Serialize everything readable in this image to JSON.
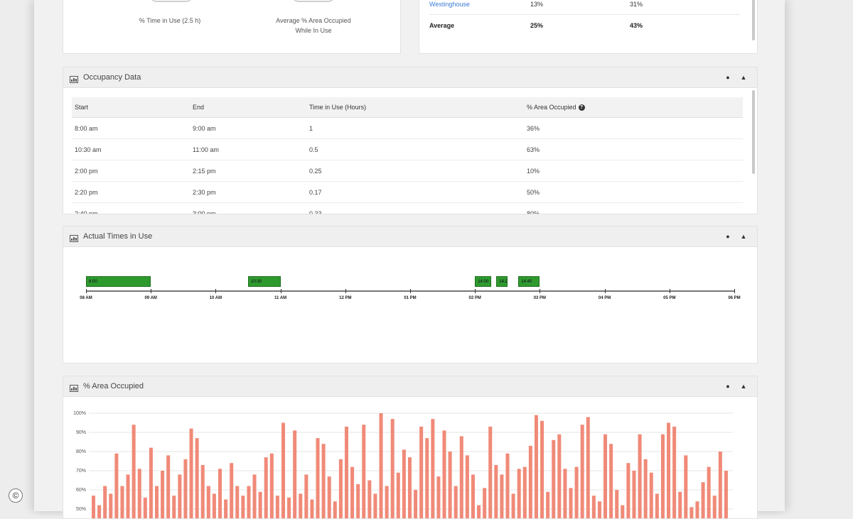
{
  "summary": {
    "stats": [
      {
        "label": "% Time in Use (2.5 h)"
      },
      {
        "label_line1": "Average % Area Occupied",
        "label_line2": "While In Use"
      }
    ],
    "rows": [
      {
        "name": "Westinghouse",
        "col2": "13%",
        "col3": "31%"
      },
      {
        "name": "Average",
        "col2": "25%",
        "col3": "43%"
      }
    ]
  },
  "occupancy": {
    "title": "Occupancy Data",
    "headers": [
      "Start",
      "End",
      "Time in Use (Hours)",
      "% Area Occupied"
    ],
    "rows": [
      [
        "8:00 am",
        "9:00 am",
        "1",
        "36%"
      ],
      [
        "10:30 am",
        "11:00 am",
        "0.5",
        "63%"
      ],
      [
        "2:00 pm",
        "2:15 pm",
        "0.25",
        "10%"
      ],
      [
        "2:20 pm",
        "2:30 pm",
        "0.17",
        "50%"
      ],
      [
        "2:40 pm",
        "3:00 pm",
        "0.33",
        "80%"
      ]
    ]
  },
  "timeline": {
    "title": "Actual Times in Use",
    "ticks": [
      "08 AM",
      "09 AM",
      "10 AM",
      "11 AM",
      "12 PM",
      "01 PM",
      "02 PM",
      "03 PM",
      "04 PM",
      "05 PM",
      "06 PM"
    ],
    "segments": [
      {
        "start": 8.0,
        "end": 9.0,
        "label": "8:00"
      },
      {
        "start": 10.5,
        "end": 11.0,
        "label": "10:30"
      },
      {
        "start": 14.0,
        "end": 14.25,
        "label": "14:00"
      },
      {
        "start": 14.33,
        "end": 14.5,
        "label": "14:20"
      },
      {
        "start": 14.67,
        "end": 15.0,
        "label": "14:40"
      }
    ]
  },
  "area": {
    "title": "% Area Occupied"
  },
  "chart_data": {
    "type": "bar",
    "title": "% Area Occupied",
    "ylim": [
      50,
      100
    ],
    "yticks": [
      "100%",
      "90%",
      "80%",
      "70%",
      "60%",
      "50%"
    ],
    "grid": true,
    "bar_color": "#f08a78",
    "values": [
      57,
      52,
      62,
      58,
      79,
      62,
      68,
      94,
      71,
      56,
      82,
      62,
      70,
      78,
      57,
      68,
      76,
      92,
      87,
      73,
      62,
      58,
      71,
      55,
      74,
      62,
      57,
      62,
      68,
      59,
      77,
      79,
      57,
      95,
      56,
      91,
      58,
      68,
      55,
      87,
      84,
      67,
      54,
      76,
      93,
      72,
      63,
      94,
      65,
      58,
      100,
      62,
      97,
      69,
      81,
      77,
      60,
      93,
      87,
      97,
      67,
      91,
      80,
      62,
      88,
      78,
      68,
      52,
      61,
      93,
      73,
      68,
      79,
      58,
      71,
      72,
      83,
      99,
      96,
      59,
      86,
      89,
      71,
      61,
      72,
      94,
      98,
      57,
      54,
      89,
      84,
      60,
      52,
      74,
      70,
      89,
      76,
      69,
      58,
      89,
      95,
      93,
      59,
      78,
      51,
      54,
      64,
      72,
      57,
      80,
      70
    ]
  }
}
